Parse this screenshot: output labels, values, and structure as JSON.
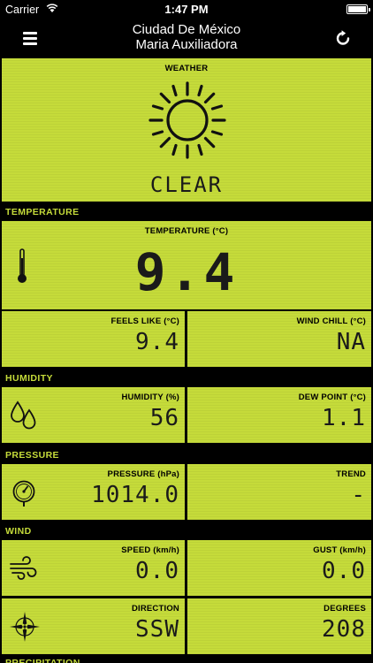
{
  "status_bar": {
    "carrier": "Carrier",
    "time": "1:47 PM"
  },
  "nav": {
    "title_line1": "Ciudad De México",
    "title_line2": "Maria Auxiliadora"
  },
  "weather": {
    "label": "WEATHER",
    "condition": "CLEAR"
  },
  "sections": {
    "temperature": "TEMPERATURE",
    "humidity": "HUMIDITY",
    "pressure": "PRESSURE",
    "wind": "WIND",
    "precipitation": "PRECIPITATION"
  },
  "temperature": {
    "label": "TEMPERATURE (°C)",
    "value": "9.4",
    "feels_like_label": "FEELS LIKE (°C)",
    "feels_like_value": "9.4",
    "wind_chill_label": "WIND CHILL (°C)",
    "wind_chill_value": "NA"
  },
  "humidity": {
    "humidity_label": "HUMIDITY (%)",
    "humidity_value": "56",
    "dew_point_label": "DEW POINT (°C)",
    "dew_point_value": "1.1"
  },
  "pressure": {
    "pressure_label": "PRESSURE (hPa)",
    "pressure_value": "1014.0",
    "trend_label": "TREND",
    "trend_value": "-"
  },
  "wind": {
    "speed_label": "SPEED (km/h)",
    "speed_value": "0.0",
    "gust_label": "GUST (km/h)",
    "gust_value": "0.0",
    "direction_label": "DIRECTION",
    "direction_value": "SSW",
    "degrees_label": "DEGREES",
    "degrees_value": "208"
  },
  "colors": {
    "lcd_background": "#c5db3a",
    "background": "#000000"
  }
}
